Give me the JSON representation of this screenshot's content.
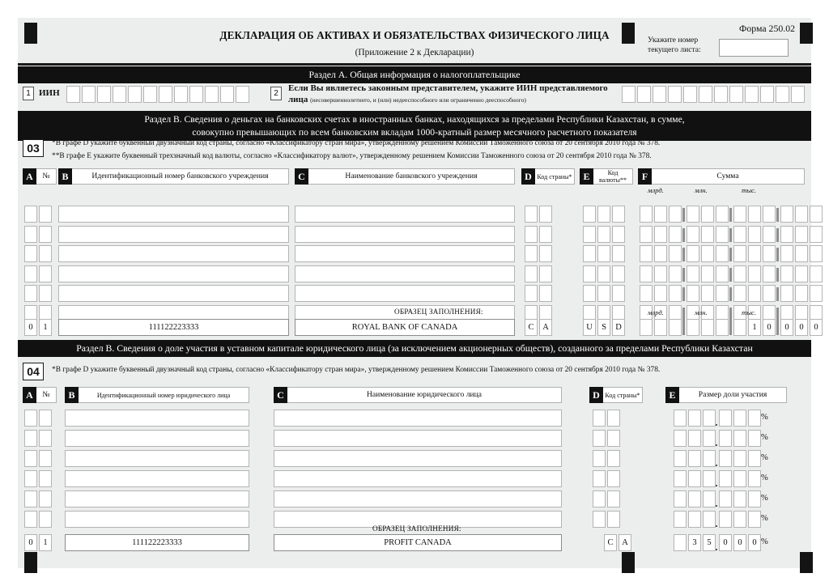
{
  "form": {
    "code_label": "Форма 250.02",
    "title": "ДЕКЛАРАЦИЯ ОБ АКТИВАХ И ОБЯЗАТЕЛЬСТВАХ ФИЗИЧЕСКОГО ЛИЦА",
    "subtitle": "(Приложение 2 к Декларации)",
    "sheet_number_label": "Укажите номер текущего листа:",
    "sheet_number_value": ""
  },
  "section_a": {
    "bar": "Раздел А. Общая информация о налогоплательщике",
    "field1": {
      "tag": "1",
      "label": "ИИН",
      "cells": 12,
      "value": ""
    },
    "field2": {
      "tag": "2",
      "label_line1": "Если Вы являетесь законным представителем, укажите ИИН представляемого",
      "label_line2_big": "лица",
      "label_line2_small": "(несовершеннолетнего, и (или) недееспособного или ограниченно дееспособного)",
      "cells": 12,
      "value": ""
    }
  },
  "section_b1": {
    "bar_line1": "Раздел В. Сведения о деньгах на банковских счетах в иностранных банках, находящихся за пределами Республики Казахстан, в сумме,",
    "bar_line2": "совокупно превышающих по всем банковским вкладам 1000-кратный размер месячного расчетного показателя",
    "block_number": "03",
    "note1": "*В графе D укажите буквенный двузначный код страны, согласно «Классификатору стран мира», утвержденному решением Комиссии Таможенного союза от 20 сентября 2010 года № 378.",
    "note2": "**В графе Е укажите буквенный трехзначный код валюты, согласно «Классификатору валют», утвержденному решением Комиссии Таможенного союза от 20 сентября 2010 года № 378.",
    "columns": [
      {
        "letter": "A",
        "caption": "№"
      },
      {
        "letter": "B",
        "caption": "Идентификационный номер банковского учреждения"
      },
      {
        "letter": "C",
        "caption": "Наименование банковского учреждения"
      },
      {
        "letter": "D",
        "caption": "Код страны*"
      },
      {
        "letter": "E",
        "caption": "Код валюты**"
      },
      {
        "letter": "F",
        "caption": "Сумма"
      }
    ],
    "sum_units": [
      "млрд.",
      "млн.",
      "тыс."
    ],
    "empty_rows": 6,
    "sample_label": "ОБРАЗЕЦ ЗАПОЛНЕНИЯ:",
    "sample_row": {
      "num": [
        "0",
        "1"
      ],
      "bank_id": "111122223333",
      "bank_name": "ROYAL BANK OF CANADA",
      "country_code": [
        "C",
        "A"
      ],
      "currency_code": [
        "U",
        "S",
        "D"
      ],
      "sum": [
        "",
        "",
        "",
        "",
        "",
        "",
        "",
        "1",
        "0",
        "0",
        "0",
        "0"
      ]
    }
  },
  "section_b2": {
    "bar": "Раздел В. Сведения о доле участия в уставном капитале юридического лица (за исключением акционерных обществ), созданного за пределами Республики Казахстан",
    "block_number": "04",
    "note1": "*В графе D укажите буквенный двузначный код страны, согласно «Классификатору стран мира», утвержденному решением Комиссии Таможенного союза от 20 сентября 2010 года № 378.",
    "columns": [
      {
        "letter": "A",
        "caption": "№"
      },
      {
        "letter": "B",
        "caption": "Идентификационный номер юридического лица"
      },
      {
        "letter": "C",
        "caption": "Наименование юридического лица"
      },
      {
        "letter": "D",
        "caption": "Код страны*"
      },
      {
        "letter": "E",
        "caption": "Размер доли участия"
      }
    ],
    "percent_sign": "%",
    "empty_rows": 6,
    "sample_label": "ОБРАЗЕЦ ЗАПОЛНЕНИЯ:",
    "sample_row": {
      "num": [
        "0",
        "1"
      ],
      "entity_id": "111122223333",
      "entity_name": "PROFIT  CANADA",
      "country_code": [
        "C",
        "A"
      ],
      "share": [
        "",
        "3",
        "5",
        "0",
        "0",
        "0"
      ]
    }
  },
  "colors": {
    "page_bg": "#ffffff",
    "sheet_bg": "#eceded",
    "bar_bg": "#111111",
    "bar_fg": "#ffffff",
    "box_border": "#b4b4b4"
  }
}
